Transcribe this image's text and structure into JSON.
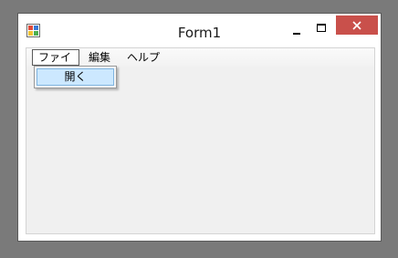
{
  "window": {
    "title": "Form1"
  },
  "menubar": {
    "items": [
      {
        "label": "ファイル"
      },
      {
        "label": "編集"
      },
      {
        "label": "ヘルプ"
      }
    ]
  },
  "dropdown": {
    "items": [
      {
        "label": "開く"
      }
    ]
  },
  "colors": {
    "desktop": "#7a7a7a",
    "close_button": "#c9504b",
    "highlight": "#cce8ff"
  }
}
